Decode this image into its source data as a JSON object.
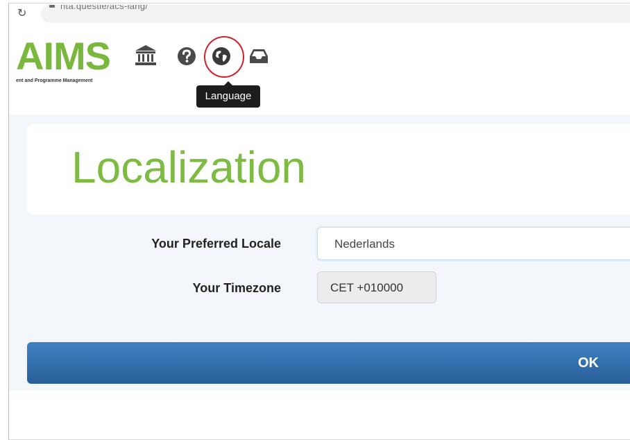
{
  "browser": {
    "url": "nta.questie/acs-lang/"
  },
  "header": {
    "logo_text": "AIMS",
    "logo_subtitle": "ent and Programme Management",
    "icons": [
      "bank-icon",
      "help-icon",
      "globe-icon",
      "inbox-icon"
    ],
    "tooltip": "Language"
  },
  "page": {
    "title": "Localization",
    "locale_label": "Your Preferred Locale",
    "locale_value": "Nederlands",
    "timezone_label": "Your Timezone",
    "timezone_value": "CET +010000",
    "ok_label": "OK"
  },
  "colors": {
    "brand_green": "#78b93d",
    "button_blue": "#2f6aa8",
    "highlight_red": "#d11f2c"
  }
}
